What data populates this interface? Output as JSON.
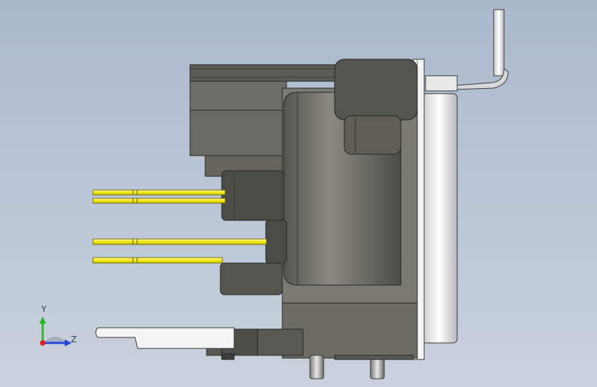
{
  "viewport": {
    "background_top": "#aab8cc",
    "background_bottom": "#c9d1dc"
  },
  "model": {
    "body_color": "#6e6e66",
    "dark_color": "#4a4a44",
    "pin_color": "#f2ea1a",
    "metal_color": "#e6e6e8"
  },
  "triad": {
    "y_label": "Y",
    "z_label": "Z",
    "y_color": "#22bb22",
    "z_color": "#2244dd",
    "x_color": "#dd2222"
  }
}
